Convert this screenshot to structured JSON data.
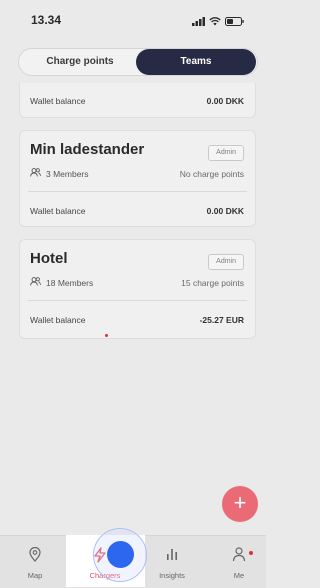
{
  "status_bar": {
    "time": "13.34",
    "icons": [
      "signal-icon",
      "wifi-icon",
      "battery-icon"
    ]
  },
  "tabs": {
    "items": [
      {
        "label": "Charge points",
        "active": false
      },
      {
        "label": "Teams",
        "active": true
      }
    ]
  },
  "teams": [
    {
      "partial": true,
      "wallet_label": "Wallet balance",
      "wallet_value": "0.00 DKK"
    },
    {
      "title": "Min ladestander",
      "badge": "Admin",
      "members": "3 Members",
      "charge_points": "No charge points",
      "wallet_label": "Wallet balance",
      "wallet_value": "0.00 DKK"
    },
    {
      "title": "Hotel",
      "badge": "Admin",
      "members": "18 Members",
      "charge_points": "15 charge points",
      "wallet_label": "Wallet balance",
      "wallet_value": "-25.27 EUR"
    }
  ],
  "fab": {
    "label": "+",
    "color": "#ea6a75"
  },
  "bottom_nav": [
    {
      "label": "Map",
      "icon": "map-pin-icon"
    },
    {
      "label": "Chargers",
      "icon": "charger-icon",
      "active": true
    },
    {
      "label": "Insights",
      "icon": "bar-chart-icon"
    },
    {
      "label": "Me",
      "icon": "user-icon"
    }
  ],
  "colors": {
    "accent_dark": "#262a44",
    "active_nav": "#e0505c",
    "touch_indicator": "#2d66ef"
  }
}
